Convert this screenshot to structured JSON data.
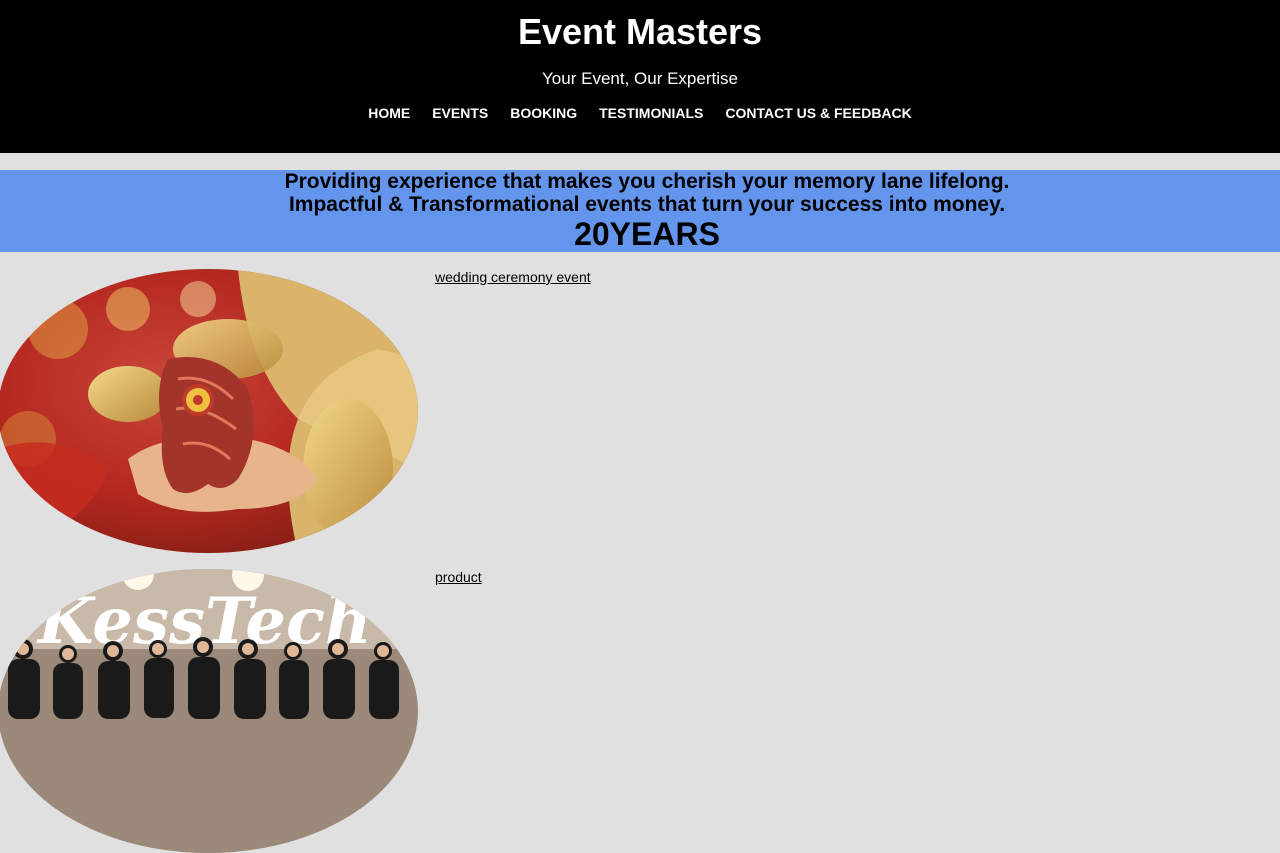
{
  "header": {
    "title": "Event Masters",
    "tagline": "Your Event, Our Expertise"
  },
  "nav": {
    "items": [
      {
        "label": "HOME"
      },
      {
        "label": "EVENTS"
      },
      {
        "label": "BOOKING"
      },
      {
        "label": "TESTIMONIALS"
      },
      {
        "label": "CONTACT US & FEEDBACK"
      }
    ]
  },
  "banner": {
    "line1": "Providing experience that makes you cherish your memory lane lifelong.",
    "line2": "Impactful & Transformational events that turn your success into money.",
    "years": "20YEARS"
  },
  "events": [
    {
      "link": "wedding ceremony event",
      "image": "wedding-hands-photo"
    },
    {
      "link": "product",
      "image": "kesstech-team-photo",
      "image_text": "KessTech"
    }
  ],
  "colors": {
    "header_bg": "#000000",
    "banner_bg": "#6495ed",
    "page_bg": "#e0e0e0"
  }
}
